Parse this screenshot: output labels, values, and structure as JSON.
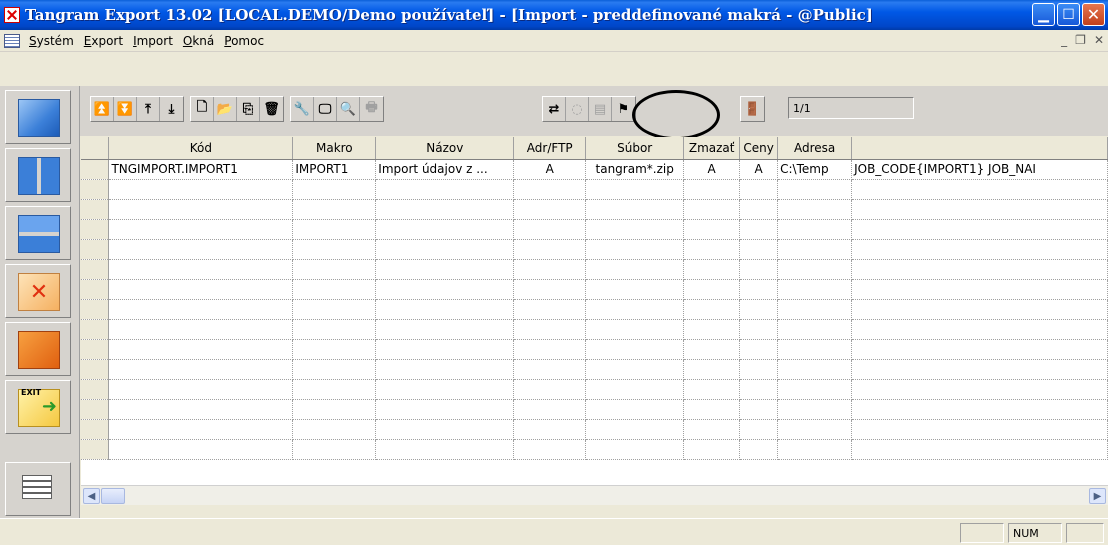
{
  "window": {
    "title": "Tangram Export 13.02 [LOCAL.DEMO/Demo používateľ] - [Import - preddefinované makrá - @Public]"
  },
  "menu": {
    "items": [
      {
        "label": "Systém",
        "accel": "S"
      },
      {
        "label": "Export",
        "accel": "E"
      },
      {
        "label": "Import",
        "accel": "I"
      },
      {
        "label": "Okná",
        "accel": "O"
      },
      {
        "label": "Pomoc",
        "accel": "P"
      }
    ]
  },
  "left_panel": {
    "exit_label": "EXIT"
  },
  "toolbar": {
    "icons": {
      "g1": [
        "first-record-icon",
        "last-record-icon",
        "move-top-icon",
        "move-bottom-icon"
      ],
      "g2": [
        "new-document-icon",
        "open-folder-icon",
        "copy-icon",
        "delete-icon"
      ],
      "g3": [
        "tools-icon",
        "monitor-icon",
        "print-preview-icon",
        "printer-icon"
      ],
      "g4": [
        "import-run-icon",
        "disabled-icon",
        "document-icon",
        "flag-icon"
      ],
      "g5": [
        "exit-door-icon"
      ]
    },
    "record_counter": "1/1"
  },
  "grid": {
    "columns": [
      "Kód",
      "Makro",
      "Názov",
      "Adr/FTP",
      "Súbor",
      "Zmazať",
      "Ceny",
      "Adresa",
      ""
    ],
    "rows": [
      [
        "TNGIMPORT.IMPORT1",
        "IMPORT1",
        "Import údajov z ...",
        "A",
        "tangram*.zip",
        "A",
        "A",
        "C:\\Temp",
        "JOB_CODE{IMPORT1} JOB_NAI"
      ]
    ]
  },
  "statusbar": {
    "num": "NUM"
  }
}
